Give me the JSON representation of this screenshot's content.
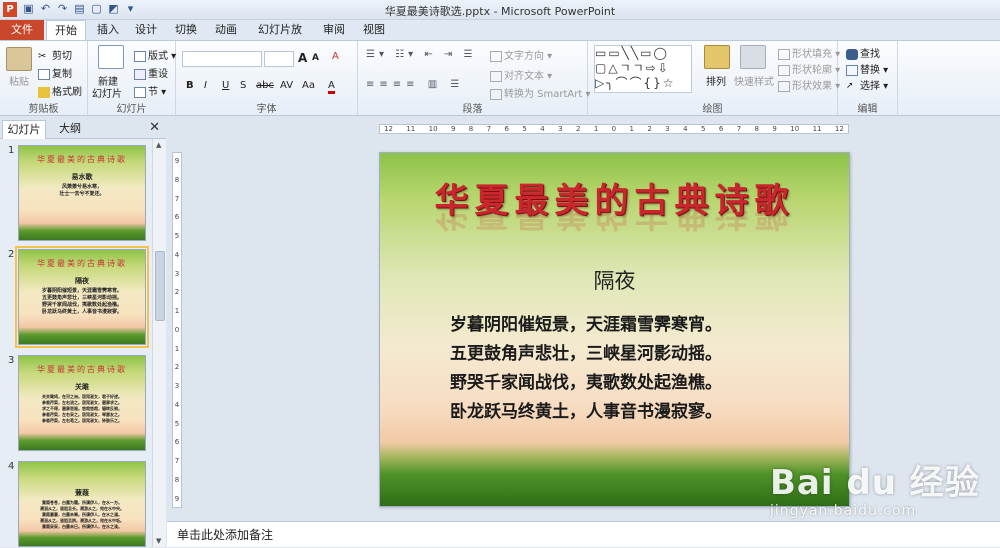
{
  "window": {
    "title": "华夏最美诗歌选.pptx - Microsoft PowerPoint",
    "app_icon": "P"
  },
  "quick_access": [
    "save-icon",
    "undo-icon",
    "redo-icon",
    "open-icon",
    "new-icon",
    "theme-icon",
    "customize-icon"
  ],
  "tabs": [
    "文件",
    "开始",
    "插入",
    "设计",
    "切换",
    "动画",
    "幻灯片放映",
    "审阅",
    "视图"
  ],
  "ribbon": {
    "clipboard": {
      "paste": "粘贴",
      "cut": "剪切",
      "copy": "复制",
      "format_painter": "格式刷",
      "label": "剪贴板"
    },
    "slides": {
      "new_slide_l1": "新建",
      "new_slide_l2": "幻灯片",
      "layout": "版式",
      "reset": "重设",
      "section": "节",
      "label": "幻灯片"
    },
    "font": {
      "bold": "B",
      "italic": "I",
      "underline": "U",
      "strike": "S",
      "shadow": "abc",
      "spacing": "AV",
      "case": "Aa",
      "color": "A",
      "grow": "A",
      "shrink": "A",
      "clear": "A",
      "label": "字体"
    },
    "paragraph": {
      "text_direction": "文字方向",
      "align_text": "对齐文本",
      "smartart": "转换为 SmartArt",
      "label": "段落"
    },
    "drawing": {
      "arrange": "排列",
      "quick_styles": "快速样式",
      "shape_fill": "形状填充",
      "shape_outline": "形状轮廓",
      "shape_effects": "形状效果",
      "label": "绘图"
    },
    "editing": {
      "find": "查找",
      "replace": "替换",
      "select": "选择",
      "label": "编辑"
    }
  },
  "left_panel": {
    "tab_slides": "幻灯片",
    "tab_outline": "大纲",
    "thumbnails": [
      {
        "num": "1",
        "title": "华夏最美的古典诗歌",
        "heading": "易水歌",
        "lines": [
          "风萧萧兮易水寒，",
          "壮士一去兮不复还。"
        ]
      },
      {
        "num": "2",
        "title": "华夏最美的古典诗歌",
        "heading": "隔夜",
        "lines": [
          "岁暮阴阳催短景，天涯霜雪霁寒宵。",
          "五更鼓角声悲壮，三峡星河影动摇。",
          "野哭千家闻战伐，夷歌数处起渔樵。",
          "卧龙跃马终黄土，人事音书漫寂寥。"
        ]
      },
      {
        "num": "3",
        "title": "华夏最美的古典诗歌",
        "heading": "关雎",
        "lines": [
          "关关雎鸠，在河之洲。窈窕淑女，君子好逑。",
          "参差荇菜，左右流之。窈窕淑女，寤寐求之。",
          "求之不得，寤寐思服。悠哉悠哉，辗转反侧。",
          "参差荇菜，左右采之。窈窕淑女，琴瑟友之。",
          "参差荇菜，左右芼之。窈窕淑女，钟鼓乐之。"
        ]
      },
      {
        "num": "4",
        "title": "",
        "heading": "蒹葭",
        "lines": [
          "蒹葭苍苍，白露为霜。所谓伊人，在水一方。",
          "溯洄从之，道阻且长。溯游从之，宛在水中央。",
          "蒹葭萋萋，白露未晞。所谓伊人，在水之湄。",
          "溯洄从之，道阻且跻。溯游从之，宛在水中坻。",
          "蒹葭采采，白露未已。所谓伊人，在水之涘。"
        ]
      }
    ]
  },
  "rulers": {
    "h_labels": [
      "12",
      "11",
      "10",
      "9",
      "8",
      "7",
      "6",
      "5",
      "4",
      "3",
      "2",
      "1",
      "0",
      "1",
      "2",
      "3",
      "4",
      "5",
      "6",
      "7",
      "8",
      "9",
      "10",
      "11",
      "12"
    ],
    "v_labels": [
      "9",
      "8",
      "7",
      "6",
      "5",
      "4",
      "3",
      "2",
      "1",
      "0",
      "1",
      "2",
      "3",
      "4",
      "5",
      "6",
      "7",
      "8",
      "9"
    ]
  },
  "slide": {
    "title": "华夏最美的古典诗歌",
    "poem_title": "隔夜",
    "poem_lines": [
      "岁暮阴阳催短景，天涯霜雪霁寒宵。",
      "五更鼓角声悲壮，三峡星河影动摇。",
      "野哭千家闻战伐，夷歌数处起渔樵。",
      "卧龙跃马终黄土，人事音书漫寂寥。"
    ]
  },
  "notes_placeholder": "单击此处添加备注",
  "watermark": {
    "logo": "Bai du 经验",
    "url": "jingyan.baidu.com"
  }
}
